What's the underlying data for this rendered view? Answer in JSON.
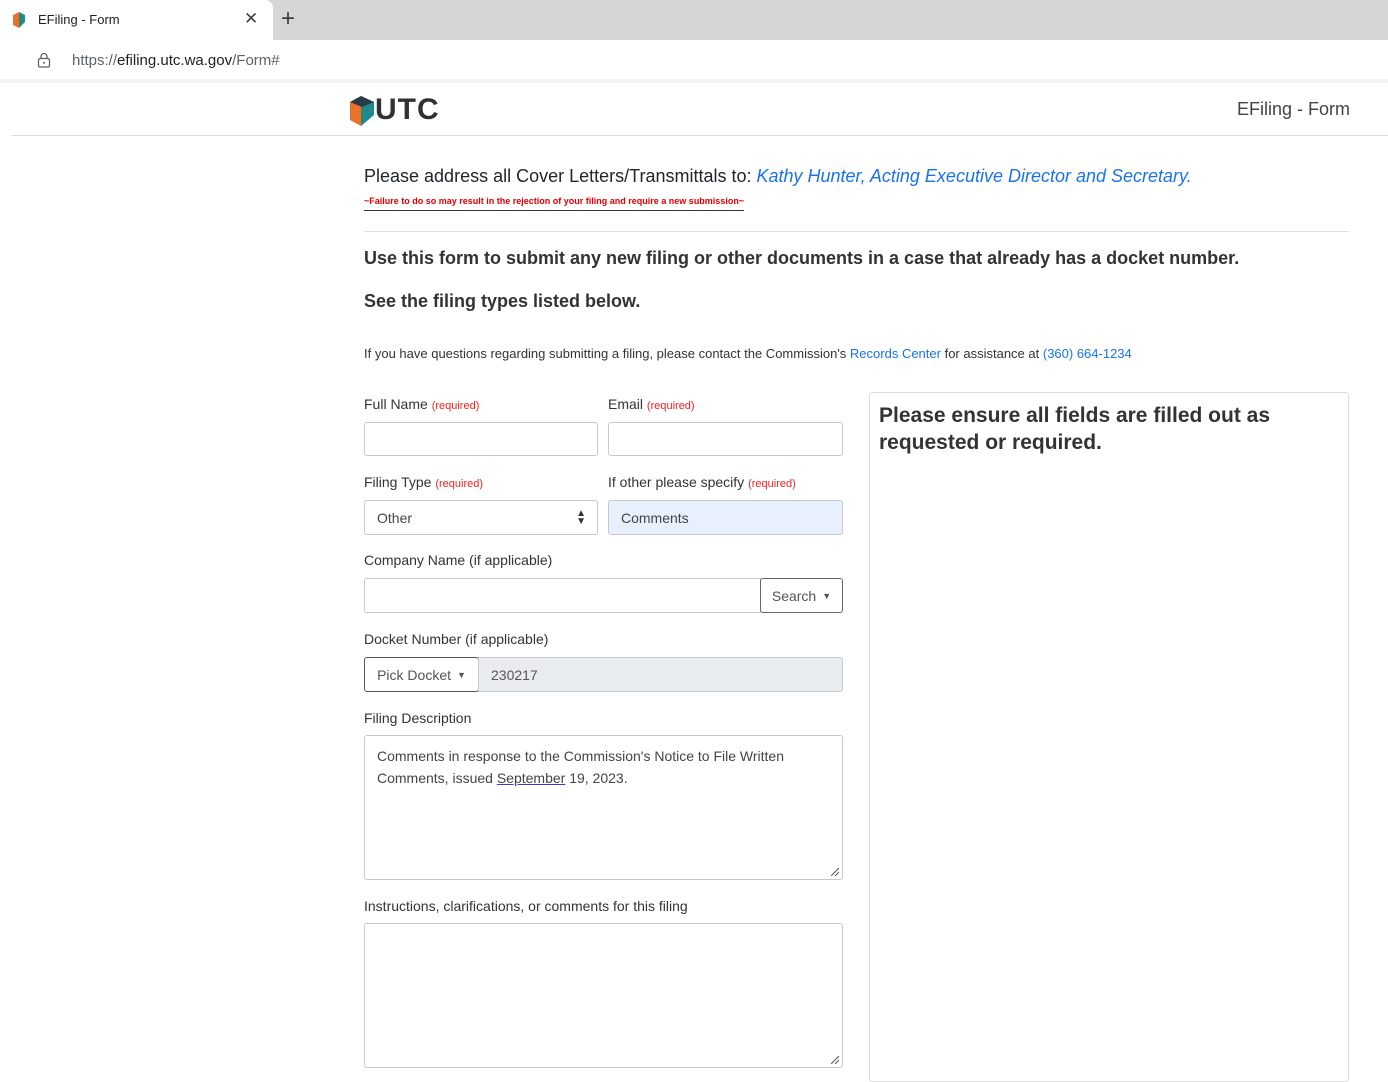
{
  "browser": {
    "tab_title": "EFiling - Form",
    "url_scheme": "https://",
    "url_domain": "efiling.utc.wa.gov",
    "url_path": "/Form#"
  },
  "header": {
    "logo_text": "UTC",
    "page_title": "EFiling - Form"
  },
  "notice": {
    "prefix": "Please address all Cover Letters/Transmittals to: ",
    "addressee": "Kathy Hunter, Acting Executive Director and Secretary.",
    "warning": "~Failure to do so may result in the rejection of your filing and require a new submission~"
  },
  "intro": {
    "line1": "Use this form to submit any new filing or other documents in a case that already has a docket number.",
    "line2": "See the filing types listed below.",
    "contact_prefix": "If you have questions regarding submitting a filing, please contact the Commission's ",
    "contact_link": "Records Center",
    "contact_mid": " for assistance at ",
    "contact_phone": "(360) 664-1234"
  },
  "form": {
    "required_tag": "(required)",
    "full_name_label": "Full Name",
    "full_name_value": "",
    "email_label": "Email",
    "email_value": "",
    "filing_type_label": "Filing Type",
    "filing_type_value": "Other",
    "other_specify_label": "If other please specify",
    "other_specify_value": "Comments",
    "company_label": "Company Name (if applicable)",
    "company_value": "",
    "search_button": "Search",
    "docket_label": "Docket Number (if applicable)",
    "pick_docket_button": "Pick Docket",
    "docket_value": "230217",
    "description_label": "Filing Description",
    "description_part1": "Comments in response to the Commission's Notice to File Written Comments, issued ",
    "description_underlined": "September",
    "description_part2": " 19, 2023.",
    "instructions_label": "Instructions, clarifications, or comments for this filing",
    "instructions_value": ""
  },
  "side_panel": {
    "message": "Please ensure all fields are filled out as requested or required."
  },
  "colors": {
    "link": "#1a73e8",
    "required": "#e22222",
    "warning": "#e00000",
    "autofill": "#e8f0fe"
  }
}
